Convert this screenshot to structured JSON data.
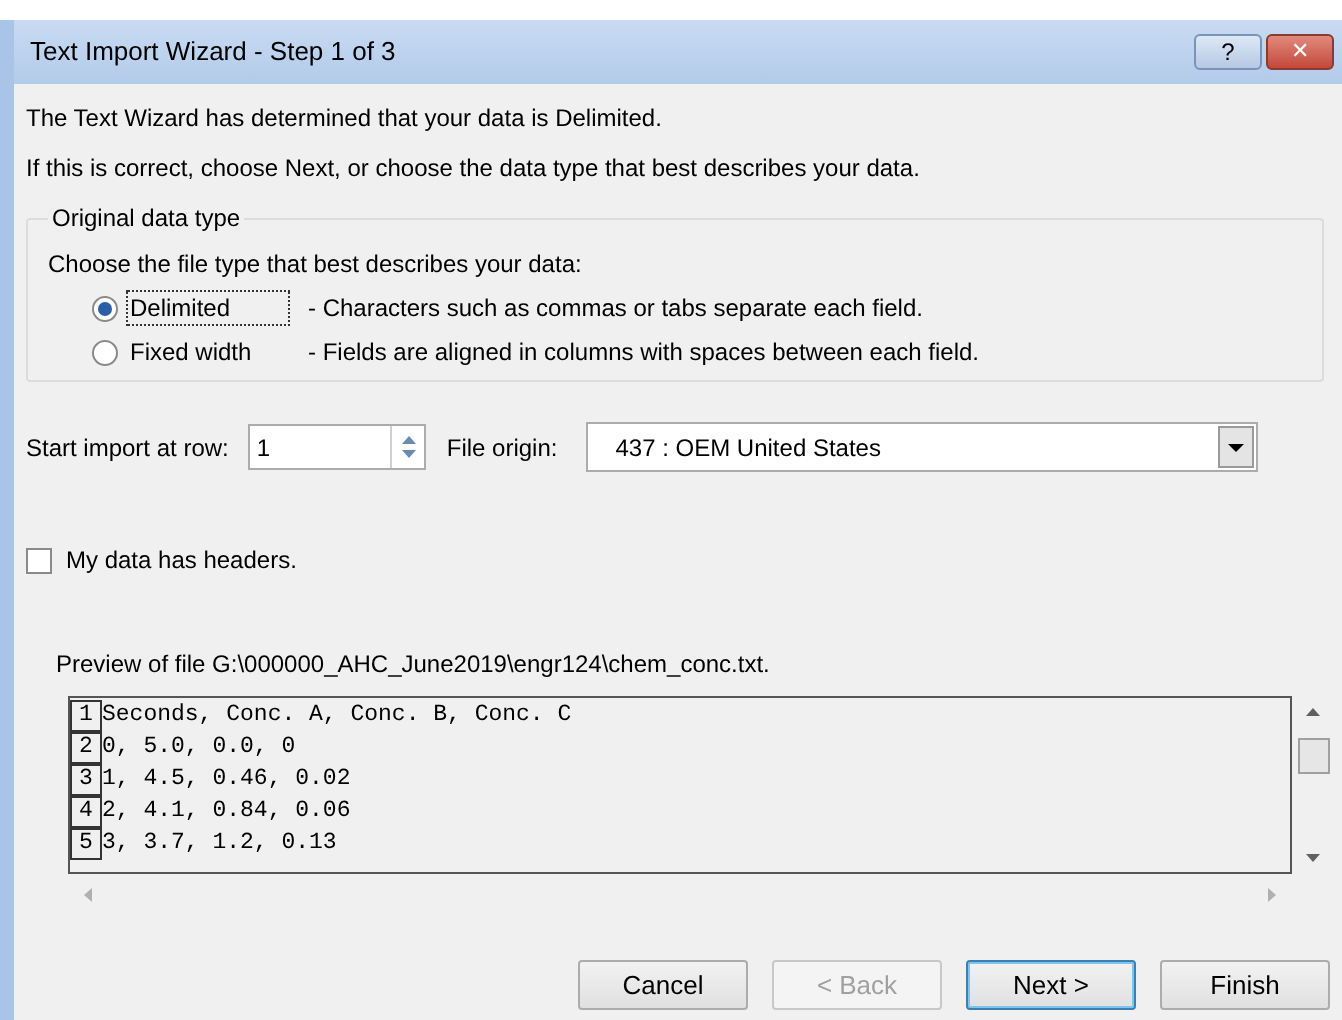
{
  "window": {
    "title": "Text Import Wizard - Step 1 of 3",
    "controls": [
      "?",
      "✕"
    ]
  },
  "intro": [
    "The Text Wizard has determined that your data is Delimited.",
    "If this is correct, choose Next, or choose the data type that best describes your data."
  ],
  "data_type": {
    "title": "Original data type",
    "prompt": "Choose the file type that best describes your data:",
    "options": [
      {
        "label": "Delimited",
        "description": "- Characters such as commas or tabs separate each field.",
        "selected": true
      },
      {
        "label": "Fixed width",
        "description": "- Fields are aligned in columns with spaces between each field.",
        "selected": false
      }
    ]
  },
  "start_row": {
    "label": "Start import at row:",
    "value": "1"
  },
  "file_origin": {
    "label": "File origin:",
    "value": "437 : OEM United States"
  },
  "headers": {
    "label": "My data has headers.",
    "checked": false
  },
  "preview": {
    "title": "Preview of file G:\\000000_AHC_June2019\\engr124\\chem_conc.txt.",
    "rows": [
      {
        "number": "1",
        "text": "Seconds, Conc. A, Conc. B, Conc. C"
      },
      {
        "number": "2",
        "text": "0, 5.0, 0.0, 0"
      },
      {
        "number": "3",
        "text": "1, 4.5, 0.46, 0.02"
      },
      {
        "number": "4",
        "text": "2, 4.1, 0.84, 0.06"
      },
      {
        "number": "5",
        "text": "3, 3.7, 1.2, 0.13"
      }
    ]
  },
  "buttons": [
    {
      "label": "Cancel",
      "disabled": false,
      "default": false
    },
    {
      "label": "< Back",
      "disabled": true,
      "default": false
    },
    {
      "label": "Next >",
      "disabled": false,
      "default": true
    },
    {
      "label": "Finish",
      "disabled": false,
      "default": false
    }
  ]
}
